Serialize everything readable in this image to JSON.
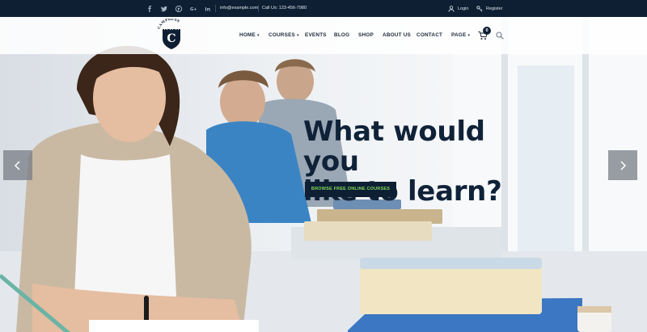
{
  "topbar": {
    "social_icons": [
      "facebook-icon",
      "twitter-icon",
      "pinterest-icon",
      "google-plus-icon",
      "linkedin-icon"
    ],
    "social_glyphs": [
      "f",
      "t",
      "p",
      "G+",
      "in"
    ],
    "email": "info@example.com",
    "phone": "Call Us: 123-456-7980",
    "login": "Login",
    "register": "Register"
  },
  "logo": {
    "arc_text": "CAMPRESS",
    "letter": "C"
  },
  "nav": {
    "items": [
      {
        "label": "HOME",
        "caret": "▾"
      },
      {
        "label": "COURSES",
        "caret": "▾"
      },
      {
        "label": "EVENTS"
      },
      {
        "label": "BLOG"
      },
      {
        "label": "SHOP"
      },
      {
        "label": "ABOUT US"
      },
      {
        "label": "CONTACT"
      },
      {
        "label": "PAGE",
        "caret": "▾"
      }
    ],
    "cart_count": "0"
  },
  "hero": {
    "headline_line1": "What would you",
    "headline_line2": "like to learn?",
    "cta": "BROWSE FREE ONLINE COURSES"
  },
  "colors": {
    "navy": "#0e1f33",
    "accent_green": "#7ed957"
  }
}
